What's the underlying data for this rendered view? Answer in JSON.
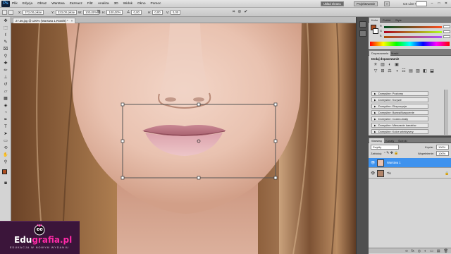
{
  "app": {
    "logo_text": "Ps"
  },
  "menu": {
    "items": [
      "Plik",
      "Edycja",
      "Obraz",
      "Warstwa",
      "Zaznacz",
      "Filtr",
      "Analiza",
      "3D",
      "Widok",
      "Okno",
      "Pomoc"
    ]
  },
  "workspace": {
    "buttons": [
      "Układ ekranu",
      "Projektowanie"
    ],
    "more": "»",
    "cslive": "CS Live ▾"
  },
  "window_controls": {
    "minimize": "–",
    "restore": "□",
    "close": "✕"
  },
  "options": {
    "x_label": "X:",
    "x_value": "372,00 pikse",
    "y_label": "Y:",
    "y_value": "323,00 pikse",
    "w_label": "W:",
    "w_value": "100,00%",
    "h_label": "H:",
    "h_value": "100,00%",
    "angle_value": "0,00",
    "h_skew_label": "H:",
    "h_skew_value": "0,00",
    "v_skew_label": "V:",
    "v_skew_value": "0,00"
  },
  "document": {
    "tab_label": "27.36.jpg @ 100% (Warstwa 1,RGB/8) *",
    "close": "×"
  },
  "watermark": {
    "brand": "Edu",
    "brand_accent": "grafia.pl",
    "tagline": "EDUKACJA W NOWYM WYDANIU"
  },
  "panels": {
    "color": {
      "tabs": [
        "Kolor",
        "Próbki",
        "Style"
      ],
      "channels": [
        {
          "label": "R",
          "color": "#c8002a"
        },
        {
          "label": "G",
          "color": "#28a028"
        },
        {
          "label": "B",
          "color": "#2040d0"
        }
      ]
    },
    "adjustments": {
      "tabs": [
        "Dopasowania",
        "Maski"
      ],
      "title": "Dodaj dopasowanie",
      "icons": [
        "☀",
        "▥",
        "◐",
        "▣",
        "▽",
        "⊞",
        "⚖",
        "◑",
        "☷",
        "▤",
        "▨",
        "◧",
        "⬓"
      ],
      "presets": [
        "Domyślne: Poziomy",
        "Domyślne: Krzywe",
        "Domyślne: Ekspozycja",
        "Domyślne: Barwa/Nasycenie",
        "Domyślne: Czarno-biały",
        "Domyślne: Mieszanie kanałów",
        "Domyślne: Kolor selektywny"
      ]
    },
    "layers": {
      "tabs": [
        "Warstwy",
        "Kanały",
        "Ścieżki"
      ],
      "blend_mode": "Zwykły",
      "opacity_label": "Krycie:",
      "opacity_value": "100%",
      "lock_label": "Zablokuj:",
      "fill_label": "Wypełnienie:",
      "fill_value": "100%",
      "rows": [
        {
          "name": "Warstwa 1",
          "selected": true
        },
        {
          "name": "Tło",
          "selected": false
        }
      ],
      "footer_icons": [
        "∞",
        "fx",
        "◎",
        "◐",
        "▭",
        "▤",
        "🗑"
      ]
    }
  },
  "colors": {
    "foreground": "#ae4e20",
    "background": "#ffffff"
  }
}
